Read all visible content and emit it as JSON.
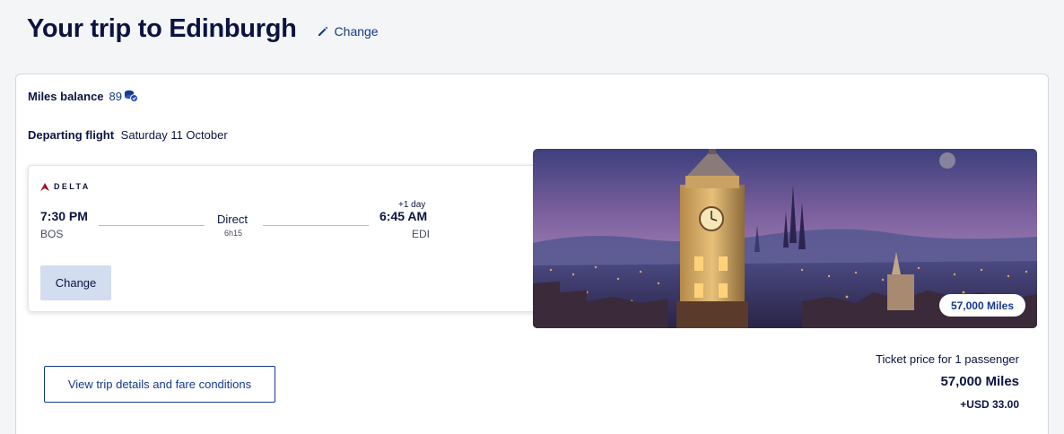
{
  "header": {
    "title": "Your trip to Edinburgh",
    "change_label": "Change"
  },
  "miles_balance": {
    "label": "Miles balance",
    "value": "89"
  },
  "departing": {
    "label": "Departing flight",
    "date": "Saturday 11 October"
  },
  "flight": {
    "airline": "DELTA",
    "departure_time": "7:30 PM",
    "departure_code": "BOS",
    "stops": "Direct",
    "duration": "6h15",
    "day_offset": "+1 day",
    "arrival_time": "6:45 AM",
    "arrival_code": "EDI",
    "change_label": "Change"
  },
  "destination_image": {
    "badge": "57,000 Miles"
  },
  "actions": {
    "trip_details_label": "View trip details and fare conditions"
  },
  "price": {
    "caption": "Ticket price for 1 passenger",
    "miles": "57,000 Miles",
    "usd": "+USD 33.00"
  },
  "colors": {
    "navy": "#0b1441",
    "link_blue": "#14398d",
    "button_light": "#d2ddef",
    "delta_red": "#c01933"
  }
}
